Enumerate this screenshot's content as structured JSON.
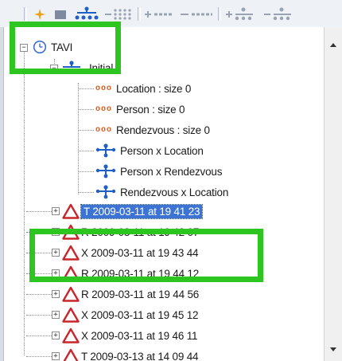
{
  "tree": {
    "root": {
      "label": "TAVI",
      "icon": "clock-icon"
    },
    "initial": {
      "label": "Initial",
      "icon": "graph-node-icon"
    },
    "children": [
      {
        "label": "Location : size 0",
        "icon": "container-icon"
      },
      {
        "label": "Person : size 0",
        "icon": "container-icon"
      },
      {
        "label": "Rendezvous : size 0",
        "icon": "container-icon"
      },
      {
        "label": "Person x Location",
        "icon": "graph-node-icon"
      },
      {
        "label": "Person x Rendezvous",
        "icon": "graph-node-icon"
      },
      {
        "label": "Rendezvous x Location",
        "icon": "graph-node-icon"
      }
    ],
    "transactions": [
      {
        "label": "T 2009-03-11 at 19 41 23",
        "icon": "warning-triangle-icon",
        "selected": true
      },
      {
        "label": "R 2009-03-11 at 19 42 07",
        "icon": "warning-triangle-icon"
      },
      {
        "label": "X 2009-03-11 at 19 43 44",
        "icon": "warning-triangle-icon"
      },
      {
        "label": "R 2009-03-11 at 19 44 12",
        "icon": "warning-triangle-icon"
      },
      {
        "label": "R 2009-03-11 at 19 44 56",
        "icon": "warning-triangle-icon"
      },
      {
        "label": "X 2009-03-11 at 19 45 12",
        "icon": "warning-triangle-icon"
      },
      {
        "label": "X 2009-03-11 at 19 46 11",
        "icon": "warning-triangle-icon"
      },
      {
        "label": "T 2009-03-13 at 14 09 44",
        "icon": "warning-triangle-icon"
      }
    ]
  },
  "toolbar": {
    "buttons": [
      "sparkle-icon",
      "square-icon",
      "tree-layout-icon",
      "dot-grid-icon",
      "dot-line-icon",
      "dash-line-icon",
      "branch-icon",
      "branch-icon"
    ]
  },
  "colors": {
    "highlight_box": "#2dc51f",
    "selection": "#3d74d4",
    "triangle": "#c8262c",
    "graph_node": "#1f5fc8",
    "container": "#e05a1a"
  }
}
